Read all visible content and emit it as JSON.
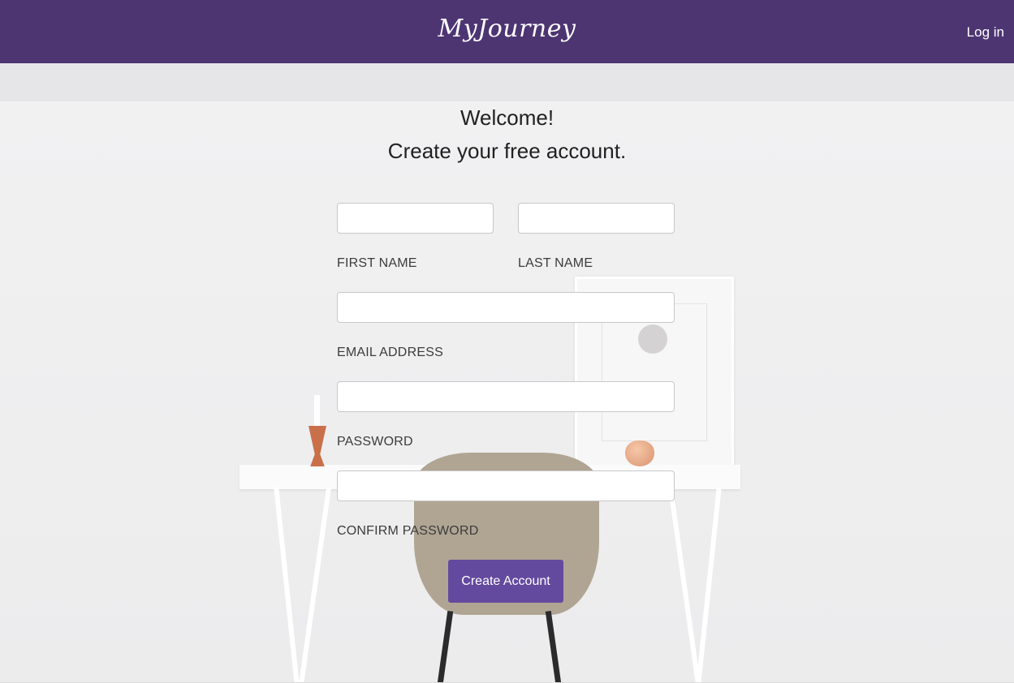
{
  "nav": {
    "brand": "MyJourney",
    "login_label": "Log in"
  },
  "header": {
    "welcome": "Welcome!",
    "subtitle": "Create your free account."
  },
  "form": {
    "first_name_label": "FIRST NAME",
    "last_name_label": "LAST NAME",
    "email_label": "EMAIL ADDRESS",
    "password_label": "PASSWORD",
    "confirm_password_label": "CONFIRM PASSWORD",
    "first_name_value": "",
    "last_name_value": "",
    "email_value": "",
    "password_value": "",
    "confirm_password_value": "",
    "submit_label": "Create Account"
  },
  "colors": {
    "navbar": "#4d3572",
    "button": "#644a9e"
  }
}
